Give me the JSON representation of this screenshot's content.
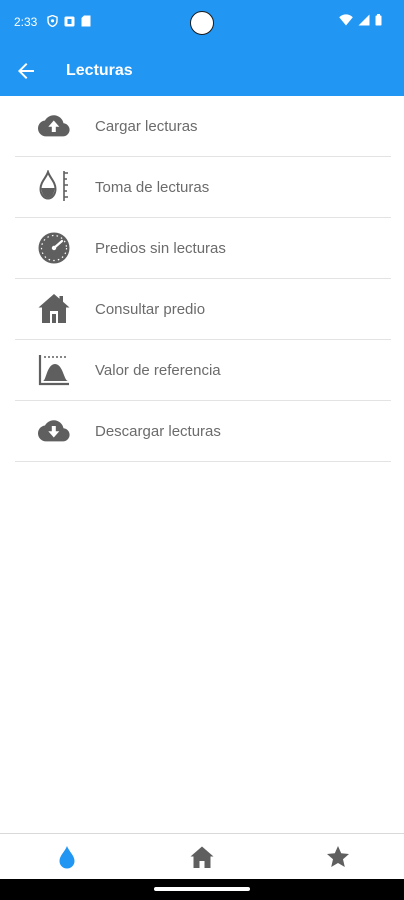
{
  "status_bar": {
    "time": "2:33",
    "left_icons": [
      "vpn-shield-icon",
      "notification-icon",
      "sim-card-icon"
    ],
    "right_icons": [
      "wifi-icon",
      "signal-icon",
      "battery-icon"
    ]
  },
  "app_bar": {
    "title": "Lecturas",
    "back_icon": "arrow-left-icon",
    "background_color": "#2196f3"
  },
  "menu": {
    "items": [
      {
        "label": "Cargar lecturas",
        "icon": "cloud-upload-icon"
      },
      {
        "label": "Toma de lecturas",
        "icon": "water-meter-drop-icon"
      },
      {
        "label": "Predios sin lecturas",
        "icon": "speedometer-icon"
      },
      {
        "label": "Consultar predio",
        "icon": "house-icon"
      },
      {
        "label": "Valor de referencia",
        "icon": "reference-value-icon"
      },
      {
        "label": "Descargar lecturas",
        "icon": "cloud-download-icon"
      }
    ],
    "label_color": "#6b6b6b",
    "icon_color": "#5f5f5f"
  },
  "bottom_nav": {
    "items": [
      {
        "icon": "water-drop-icon",
        "active": true,
        "color": "#2196f3"
      },
      {
        "icon": "home-icon",
        "active": false,
        "color": "#5f5f5f"
      },
      {
        "icon": "star-icon",
        "active": false,
        "color": "#5f5f5f"
      }
    ]
  }
}
